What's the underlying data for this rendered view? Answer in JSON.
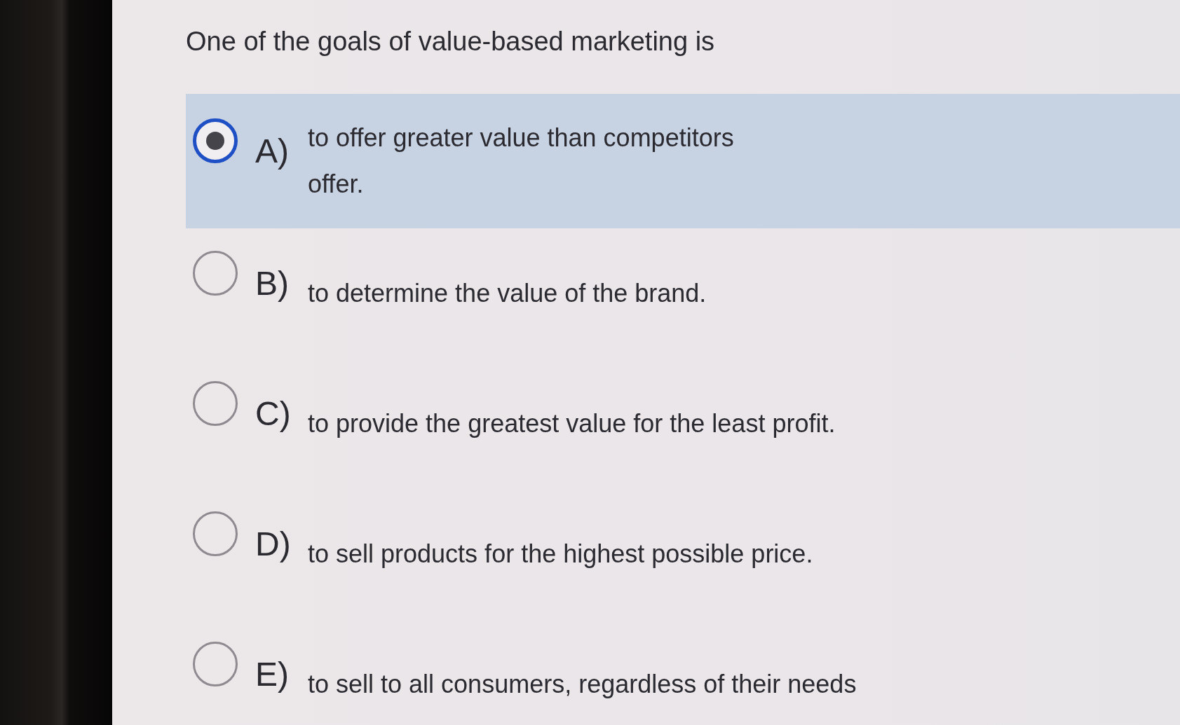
{
  "question": "One of the goals of value-based marketing is",
  "options": [
    {
      "letter": "A)",
      "text": "to offer greater value than competitors\noffer.",
      "selected": true
    },
    {
      "letter": "B)",
      "text": "to determine the value of the brand.",
      "selected": false
    },
    {
      "letter": "C)",
      "text": "to provide the greatest value for the least profit.",
      "selected": false
    },
    {
      "letter": "D)",
      "text": "to sell products for the highest possible price.",
      "selected": false
    },
    {
      "letter": "E)",
      "text": "to sell to all consumers, regardless of their needs",
      "selected": false
    }
  ]
}
